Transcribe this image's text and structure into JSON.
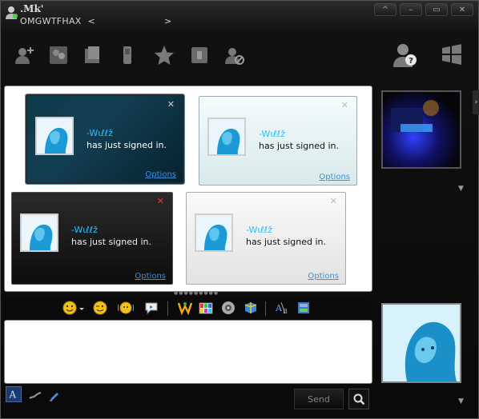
{
  "window": {
    "user_name": ".Mk'",
    "status_text": "OMGWTFHAX",
    "status_left_arrow": "<",
    "status_right_arrow": ">",
    "controls": {
      "minimize": "^",
      "restore": "–",
      "maximize": "▭",
      "close": "✕"
    }
  },
  "toolbar": {
    "icons": [
      "add-contact-icon",
      "invite-contact-icon",
      "share-files-icon",
      "phone-icon",
      "activities-icon",
      "games-icon",
      "block-icon",
      "contact-card-icon",
      "windows-logo-icon"
    ]
  },
  "toasts": [
    {
      "contact": "-Wιℓℓž",
      "message": "has just signed in.",
      "options": "Options",
      "close": "✕"
    },
    {
      "contact": "-Wιℓℓž",
      "message": "has just signed in.",
      "options": "Options",
      "close": "✕"
    },
    {
      "contact": "-Wιℓℓž",
      "message": "has just signed in.",
      "options": "Options",
      "close": "✕"
    },
    {
      "contact": "-Wιℓℓž",
      "message": "has just signed in.",
      "options": "Options",
      "close": "✕"
    }
  ],
  "format_toolbar": {
    "icons": [
      "emoticon-icon",
      "wink-icon",
      "nudge-icon",
      "voice-clip-icon",
      "winks-icon",
      "backgrounds-icon",
      "sound-icon",
      "games-icon",
      "font-icon",
      "print-icon"
    ]
  },
  "compose": {
    "input_value": "",
    "send_label": "Send"
  },
  "bottom": {
    "icons": [
      "font-style-icon",
      "handwriting-icon",
      "ink-icon",
      "search-icon"
    ]
  },
  "colors": {
    "contact_name": "#2cc0ff",
    "link": "#3d8fdb",
    "window_bg": "#0d0d0d"
  }
}
